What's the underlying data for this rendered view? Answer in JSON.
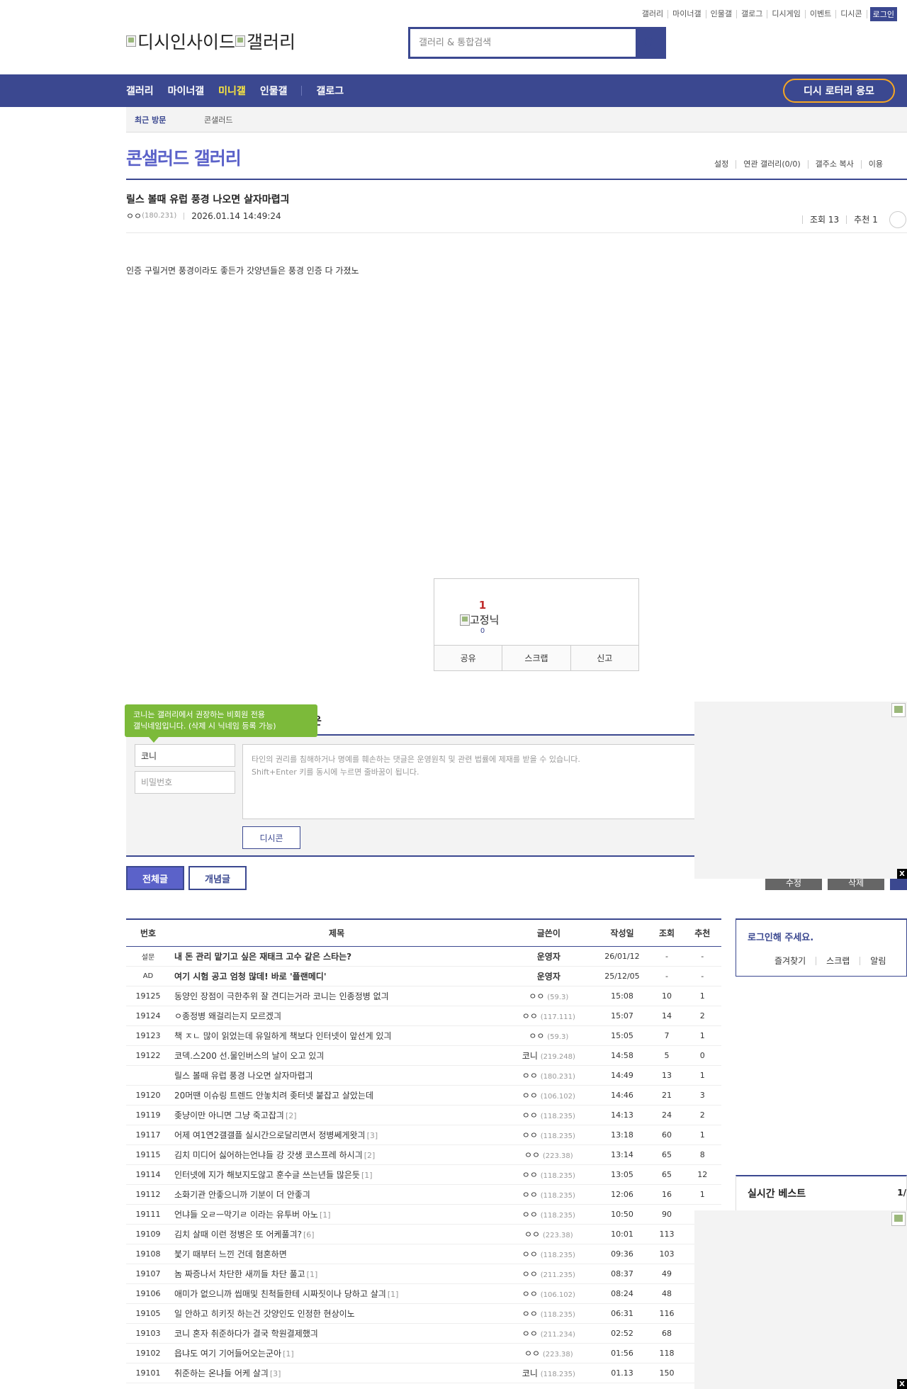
{
  "top_links": [
    "갤러리",
    "마이너갤",
    "인물갤",
    "갤로그",
    "디시게임",
    "이벤트",
    "디시콘"
  ],
  "login_label": "로그인",
  "logo": {
    "alt1": "디시인사이드",
    "alt2": "갤러리"
  },
  "search": {
    "placeholder": "갤러리 & 통합검색"
  },
  "nav": {
    "items": [
      "갤러리",
      "마이너갤",
      "미니갤",
      "인물갤"
    ],
    "active": "미니갤",
    "gallog": "갤로그",
    "lottery": "디시 로터리 응모"
  },
  "subnav": {
    "recent": "최근 방문",
    "item": "콘샐러드"
  },
  "gallery": {
    "title": "콘샐러드 갤러리",
    "tools": [
      "설정",
      "연관 갤러리(0/0)",
      "갤주소 복사",
      "이용"
    ]
  },
  "post": {
    "title": "릴스 볼때 유럽 풍경 나오면 살자마렵긔",
    "author": "ㅇㅇ",
    "ip": "(180.231)",
    "date": "2026.01.14 14:49:24",
    "views": "조회 13",
    "recommends": "추천 1",
    "body": "인증 구릴거면 풍경이라도 좋든가 갓양년들은 풍경 인증 다 가졌노"
  },
  "recommend": {
    "count": "1",
    "img_alt": "고정닉",
    "fixed_count": "0",
    "buttons": [
      "공유",
      "스크랩",
      "신고"
    ]
  },
  "comment": {
    "tip_line1": "코니는 갤러리에서 권장하는 비회원 전용",
    "tip_line2": "갤닉네임입니다. (삭제 시 닉네임 등록 가능)",
    "header_partial": "운",
    "name_value": "코니",
    "pw_placeholder": "비밀번호",
    "text_placeholder": "타인의 권리를 침해하거나 명예를 훼손하는 댓글은 운영원칙 및 관련 법률에 제재를 받을 수 있습니다.\nShift+Enter 키를 동시에 누르면 줄바꿈이 됩니다.",
    "dccon": "디시콘"
  },
  "list_buttons": {
    "all": "전체글",
    "concept": "개념글",
    "btn1": "수정",
    "btn2": "삭제"
  },
  "table": {
    "headers": [
      "번호",
      "제목",
      "글쓴이",
      "작성일",
      "조회",
      "추천"
    ],
    "rows": [
      {
        "num": "설문",
        "title": "내 돈 관리 맡기고 싶은 재태크 고수 같은 스타는?",
        "reply": "",
        "writer": "운영자",
        "ip": "",
        "date": "26/01/12",
        "views": "-",
        "rec": "-",
        "notice": true
      },
      {
        "num": "AD",
        "title": "여기 시험 공고 엄청 많데! 바로 '플랜메디'",
        "reply": "",
        "writer": "운영자",
        "ip": "",
        "date": "25/12/05",
        "views": "-",
        "rec": "-",
        "notice": true
      },
      {
        "num": "19125",
        "title": "동양인 장점이 극한추위 잘 견디는거라 코니는 인종정병 없긔",
        "reply": "",
        "writer": "ㅇㅇ",
        "ip": "(59.3)",
        "date": "15:08",
        "views": "10",
        "rec": "1"
      },
      {
        "num": "19124",
        "title": "ㅇ종정병 왜걸리는지 모르겠긔",
        "reply": "",
        "writer": "ㅇㅇ",
        "ip": "(117.111)",
        "date": "15:07",
        "views": "14",
        "rec": "2"
      },
      {
        "num": "19123",
        "title": "책 ㅈㄴ 많이 읽었는데 유일하게 책보다 인터넷이 앞선게 있긔",
        "reply": "",
        "writer": "ㅇㅇ",
        "ip": "(59.3)",
        "date": "15:05",
        "views": "7",
        "rec": "1"
      },
      {
        "num": "19122",
        "title": "코덱.스200 선.물인버스의 날이 오고 있긔",
        "reply": "",
        "writer": "코니",
        "ip": "(219.248)",
        "date": "14:58",
        "views": "5",
        "rec": "0"
      },
      {
        "num": "",
        "title": "릴스 볼때 유럽 풍경 나오면 살자마렵긔",
        "reply": "",
        "writer": "ㅇㅇ",
        "ip": "(180.231)",
        "date": "14:49",
        "views": "13",
        "rec": "1"
      },
      {
        "num": "19120",
        "title": "20머땐 이슈링 트렌드 안놓치려 좆터넷 붙잡고 살았는데",
        "reply": "",
        "writer": "ㅇㅇ",
        "ip": "(106.102)",
        "date": "14:46",
        "views": "21",
        "rec": "3"
      },
      {
        "num": "19119",
        "title": "좆냥이만 아니면 그냥 죽고잡긔",
        "reply": "[2]",
        "writer": "ㅇㅇ",
        "ip": "(118.235)",
        "date": "14:13",
        "views": "24",
        "rec": "2"
      },
      {
        "num": "19117",
        "title": "어제 여1연2갤갤플 실시간으로달리면서 정병쎄게왓긔",
        "reply": "[3]",
        "writer": "ㅇㅇ",
        "ip": "(118.235)",
        "date": "13:18",
        "views": "60",
        "rec": "1"
      },
      {
        "num": "19115",
        "title": "김치 미디어 싫어하는언냐들 강 갓생 코스프레 하시긔",
        "reply": "[2]",
        "writer": "ㅇㅇ",
        "ip": "(223.38)",
        "date": "13:14",
        "views": "65",
        "rec": "8"
      },
      {
        "num": "19114",
        "title": "인터넷에 지가 해보지도않고 훈수글 쓰는년들 많은듯",
        "reply": "[1]",
        "writer": "ㅇㅇ",
        "ip": "(118.235)",
        "date": "13:05",
        "views": "65",
        "rec": "12"
      },
      {
        "num": "19112",
        "title": "소화기관 안좋으니까 기분이 더 안좋긔",
        "reply": "",
        "writer": "ㅇㅇ",
        "ip": "(118.235)",
        "date": "12:06",
        "views": "16",
        "rec": "1"
      },
      {
        "num": "19111",
        "title": "언냐들 오ㄹㅡ막기ㄹ 이라는 유투버 아노",
        "reply": "[1]",
        "writer": "ㅇㅇ",
        "ip": "(118.235)",
        "date": "10:50",
        "views": "90",
        "rec": ""
      },
      {
        "num": "19109",
        "title": "김치 살때 이런 정병은 또 어케풀긔?",
        "reply": "[6]",
        "writer": "ㅇㅇ",
        "ip": "(223.38)",
        "date": "10:01",
        "views": "113",
        "rec": ""
      },
      {
        "num": "19108",
        "title": "붗기 때부터 느낀 건데 혐혼하면",
        "reply": "",
        "writer": "ㅇㅇ",
        "ip": "(118.235)",
        "date": "09:36",
        "views": "103",
        "rec": ""
      },
      {
        "num": "19107",
        "title": "놈 짜증나서 차단한 새끼들 차단 풀고",
        "reply": "[1]",
        "writer": "ㅇㅇ",
        "ip": "(211.235)",
        "date": "08:37",
        "views": "49",
        "rec": ""
      },
      {
        "num": "19106",
        "title": "애미가 없으니까 씹매및 친척들한테 시짜짓이나 당하고 살긔",
        "reply": "[1]",
        "writer": "ㅇㅇ",
        "ip": "(106.102)",
        "date": "08:24",
        "views": "48",
        "rec": ""
      },
      {
        "num": "19105",
        "title": "일 안하고 히키짓 하는건 갓양인도 인정한 현상이노",
        "reply": "",
        "writer": "ㅇㅇ",
        "ip": "(118.235)",
        "date": "06:31",
        "views": "116",
        "rec": ""
      },
      {
        "num": "19103",
        "title": "코니 혼자 취준하다가 결국 학원결제했긔",
        "reply": "",
        "writer": "ㅇㅇ",
        "ip": "(211.234)",
        "date": "02:52",
        "views": "68",
        "rec": ""
      },
      {
        "num": "19102",
        "title": "읍냐도 여기 기어들어오는군아",
        "reply": "[1]",
        "writer": "ㅇㅇ",
        "ip": "(223.38)",
        "date": "01:56",
        "views": "118",
        "rec": ""
      },
      {
        "num": "19101",
        "title": "취준하는 온냐들 어케 살긔",
        "reply": "[3]",
        "writer": "코니",
        "ip": "(118.235)",
        "date": "01.13",
        "views": "150",
        "rec": ""
      }
    ]
  },
  "sidebar": {
    "login_title": "로그인해 주세요.",
    "login_tabs": [
      "즐겨찾기",
      "스크랩",
      "알림"
    ],
    "best_title": "실시간 베스트",
    "best_page": "1/"
  },
  "ad": {
    "close": "X"
  },
  "colors": {
    "brand": "#3b4890",
    "accent": "#5b62c9",
    "active_nav": "#ffea3d",
    "lottery_border": "#f5a623",
    "tip_green": "#7cba3a"
  }
}
